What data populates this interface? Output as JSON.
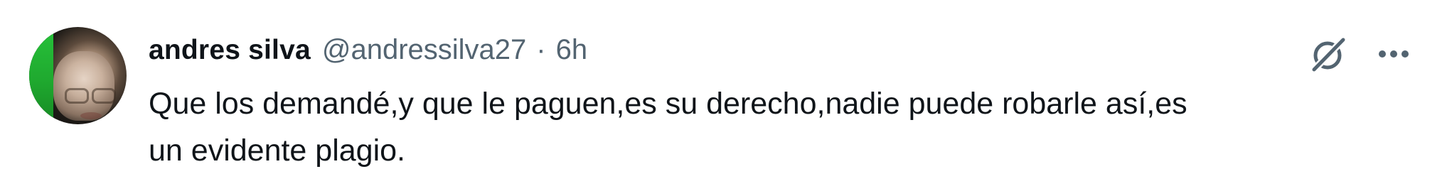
{
  "tweet": {
    "author": {
      "display_name": "andres silva",
      "handle": "@andressilva27",
      "separator": "·",
      "time": "6h",
      "avatar_icon": "profile-photo"
    },
    "text": "Que los demandé,y que le paguen,es su derecho,nadie puede robarle así,es\nun evidente plagio.",
    "actions": {
      "grok_icon": "grok-icon",
      "more_icon": "more-icon"
    },
    "colors": {
      "name": "#0f1419",
      "secondary": "#536471",
      "background": "#ffffff"
    }
  }
}
